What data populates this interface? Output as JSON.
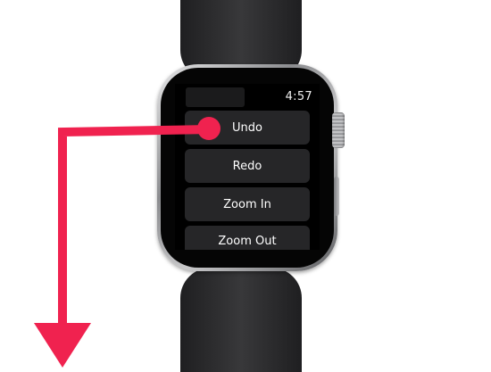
{
  "watch": {
    "time": "4:57",
    "menu_items": [
      {
        "label": "Undo"
      },
      {
        "label": "Redo"
      },
      {
        "label": "Zoom In"
      },
      {
        "label": "Zoom Out"
      }
    ]
  },
  "annotation": {
    "type": "touch-indicator-with-arrow",
    "direction": "down",
    "target": "Undo",
    "color": "#f0224f"
  },
  "colors": {
    "accent": "#f0224f",
    "band": "#2b2b2d",
    "screen_background": "#000000",
    "button_background": "#262628",
    "button_text": "#ffffff"
  }
}
